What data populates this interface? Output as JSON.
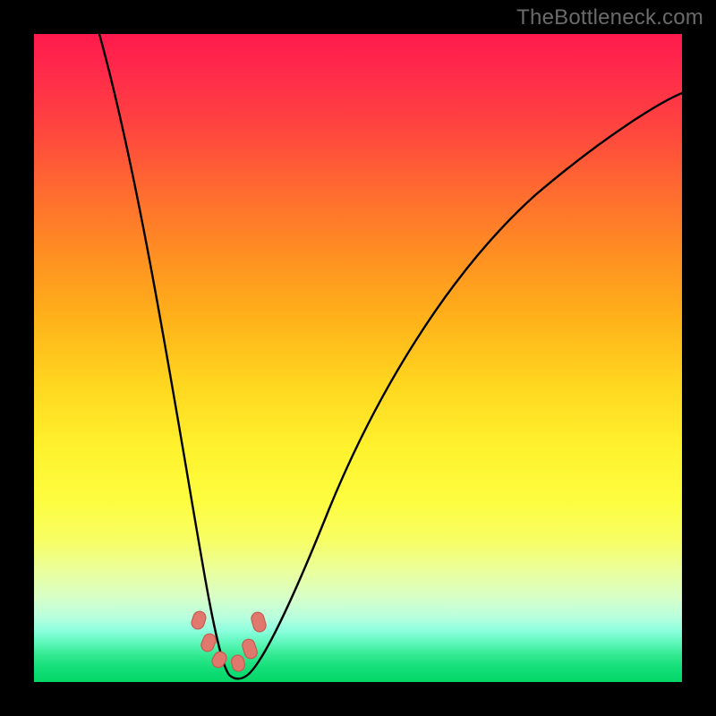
{
  "watermark": "TheBottleneck.com",
  "chart_data": {
    "type": "line",
    "title": "",
    "xlabel": "",
    "ylabel": "",
    "xlim": [
      0,
      100
    ],
    "ylim": [
      0,
      100
    ],
    "x": [
      10,
      12,
      14,
      16,
      18,
      20,
      22,
      24,
      25,
      26,
      27,
      28,
      29,
      30,
      31,
      32,
      33,
      34,
      36,
      40,
      45,
      50,
      55,
      60,
      65,
      70,
      75,
      80,
      85,
      90,
      95,
      100
    ],
    "values": [
      100,
      91,
      82,
      73,
      63,
      53,
      42,
      30,
      22,
      14,
      8,
      3,
      1,
      0,
      0,
      1,
      3,
      6,
      12,
      24,
      37,
      47,
      55,
      62,
      67,
      72,
      76,
      79,
      82,
      84,
      86,
      88
    ],
    "markers": {
      "x": [
        25.2,
        26.6,
        28.0,
        30.8,
        32.8,
        34.0
      ],
      "y": [
        9.5,
        6.2,
        4.3,
        4.0,
        6.0,
        10.5
      ]
    },
    "gradient_meaning": "red=high bottleneck, green=low bottleneck"
  }
}
